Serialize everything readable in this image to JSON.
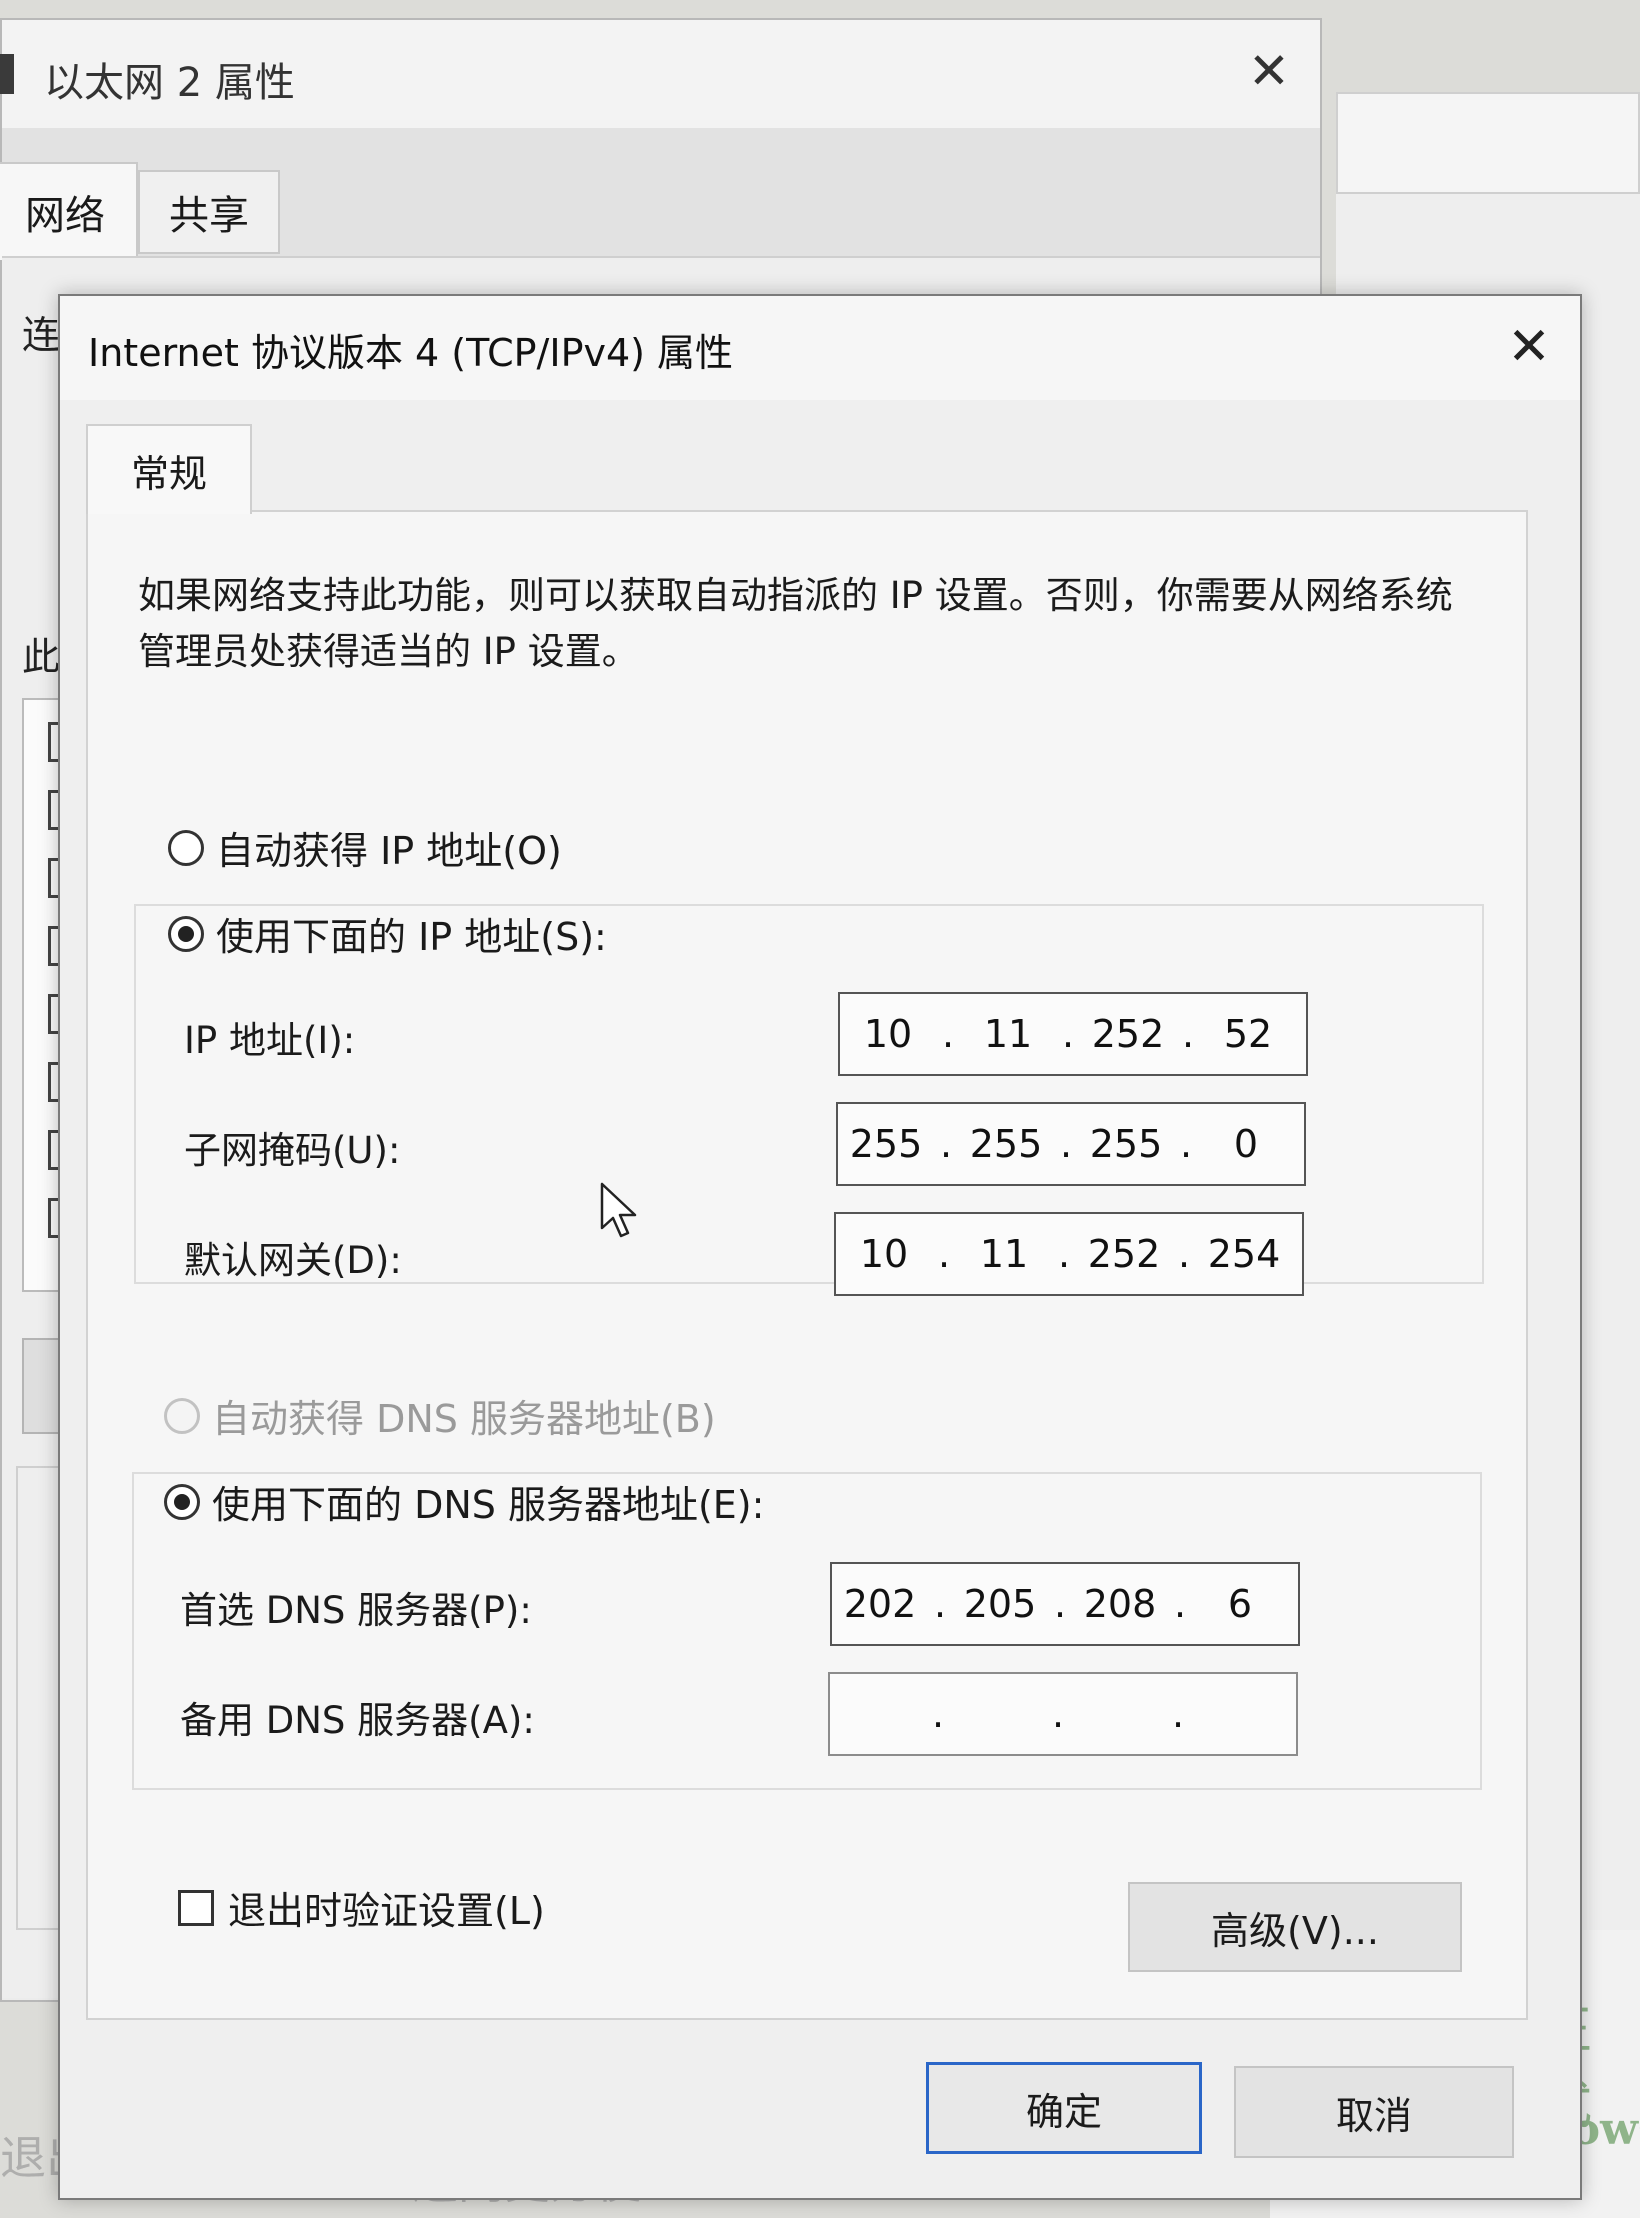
{
  "bg_window": {
    "title": "以太网 2 属性",
    "tabs": [
      "网络",
      "共享"
    ],
    "partial_label_1": "连",
    "partial_label_2": "此"
  },
  "background_fragments": {
    "right_text_1": "正式",
    "right_text_2": "dows",
    "bottom_left": "退出时",
    "bottom_mid": "连网更方便"
  },
  "dialog": {
    "title": "Internet 协议版本 4 (TCP/IPv4) 属性",
    "tab": "常规",
    "intro": "如果网络支持此功能，则可以获取自动指派的 IP 设置。否则，你需要从网络系统管理员处获得适当的 IP 设置。",
    "ip_section": {
      "auto_option": "自动获得 IP 地址(O)",
      "manual_option": "使用下面的 IP 地址(S):",
      "selected": "manual",
      "fields": [
        {
          "label": "IP 地址(I):",
          "octets": [
            "10",
            "11",
            "252",
            "52"
          ]
        },
        {
          "label": "子网掩码(U):",
          "octets": [
            "255",
            "255",
            "255",
            "0"
          ]
        },
        {
          "label": "默认网关(D):",
          "octets": [
            "10",
            "11",
            "252",
            "254"
          ]
        }
      ]
    },
    "dns_section": {
      "auto_option": "自动获得 DNS 服务器地址(B)",
      "manual_option": "使用下面的 DNS 服务器地址(E):",
      "auto_disabled": true,
      "selected": "manual",
      "fields": [
        {
          "label": "首选 DNS 服务器(P):",
          "octets": [
            "202",
            "205",
            "208",
            "6"
          ]
        },
        {
          "label": "备用 DNS 服务器(A):",
          "octets": [
            "",
            "",
            "",
            ""
          ]
        }
      ]
    },
    "validate_on_exit": {
      "label": "退出时验证设置(L)",
      "checked": false
    },
    "advanced_button": "高级(V)...",
    "ok_button": "确定",
    "cancel_button": "取消"
  },
  "colors": {
    "focus_border": "#2a66c8"
  },
  "icons": {
    "close": "close-icon",
    "cursor": "mouse-pointer-icon"
  }
}
